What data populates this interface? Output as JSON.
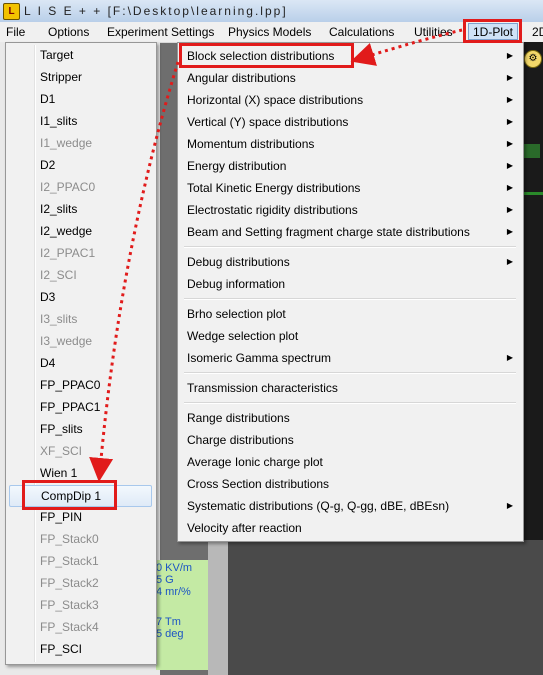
{
  "window": {
    "title": "L I S E + +  [F:\\Desktop\\learning.lpp]",
    "icon": "lise-app-icon"
  },
  "menubar": {
    "items": [
      "File",
      "Options",
      "Experiment Settings",
      "Physics Models",
      "Calculations",
      "Utilities",
      "1D-Plot",
      "2D"
    ]
  },
  "left_menu": {
    "items": [
      {
        "label": "Target",
        "enabled": true
      },
      {
        "label": "Stripper",
        "enabled": true
      },
      {
        "label": "D1",
        "enabled": true
      },
      {
        "label": "I1_slits",
        "enabled": true
      },
      {
        "label": "I1_wedge",
        "enabled": false
      },
      {
        "label": "D2",
        "enabled": true
      },
      {
        "label": "I2_PPAC0",
        "enabled": false
      },
      {
        "label": "I2_slits",
        "enabled": true
      },
      {
        "label": "I2_wedge",
        "enabled": true
      },
      {
        "label": "I2_PPAC1",
        "enabled": false
      },
      {
        "label": "I2_SCI",
        "enabled": false
      },
      {
        "label": "D3",
        "enabled": true
      },
      {
        "label": "I3_slits",
        "enabled": false
      },
      {
        "label": "I3_wedge",
        "enabled": false
      },
      {
        "label": "D4",
        "enabled": true
      },
      {
        "label": "FP_PPAC0",
        "enabled": true
      },
      {
        "label": "FP_PPAC1",
        "enabled": true
      },
      {
        "label": "FP_slits",
        "enabled": true
      },
      {
        "label": "XF_SCI",
        "enabled": false
      },
      {
        "label": "Wien 1",
        "enabled": true
      },
      {
        "label": "CompDip 1",
        "enabled": true,
        "selected": true
      },
      {
        "label": "FP_PIN",
        "enabled": true
      },
      {
        "label": "FP_Stack0",
        "enabled": false
      },
      {
        "label": "FP_Stack1",
        "enabled": false
      },
      {
        "label": "FP_Stack2",
        "enabled": false
      },
      {
        "label": "FP_Stack3",
        "enabled": false
      },
      {
        "label": "FP_Stack4",
        "enabled": false
      },
      {
        "label": "FP_SCI",
        "enabled": true
      }
    ]
  },
  "right_menu": {
    "groups": [
      [
        {
          "label": "Block selection distributions",
          "submenu": true
        },
        {
          "label": "Angular distributions",
          "submenu": true
        },
        {
          "label": "Horizontal (X) space  distributions",
          "submenu": true
        },
        {
          "label": "Vertical (Y) space  distributions",
          "submenu": true
        },
        {
          "label": "Momentum distributions",
          "submenu": true
        },
        {
          "label": "Energy distribution",
          "submenu": true
        },
        {
          "label": "Total Kinetic Energy distributions",
          "submenu": true
        },
        {
          "label": "Electrostatic rigidity distributions",
          "submenu": true
        },
        {
          "label": "Beam and Setting fragment charge state distributions",
          "submenu": true
        }
      ],
      [
        {
          "label": "Debug distributions",
          "submenu": true
        },
        {
          "label": "Debug information",
          "submenu": false
        }
      ],
      [
        {
          "label": "Brho selection plot",
          "submenu": false
        },
        {
          "label": "Wedge selection plot",
          "submenu": false
        },
        {
          "label": "Isomeric Gamma spectrum",
          "submenu": true
        }
      ],
      [
        {
          "label": "Transmission characteristics",
          "submenu": false
        }
      ],
      [
        {
          "label": "Range distributions",
          "submenu": false
        },
        {
          "label": "Charge distributions",
          "submenu": false
        },
        {
          "label": "Average Ionic charge plot",
          "submenu": false
        },
        {
          "label": "Cross Section distributions",
          "submenu": false
        },
        {
          "label": "Systematic distributions (Q-g, Q-gg, dBE, dBEsn)",
          "submenu": true
        },
        {
          "label": "Velocity after reaction",
          "submenu": false
        }
      ]
    ]
  },
  "background_panel": {
    "lines": [
      "0 KV/m",
      "5 G",
      "4 mr/%",
      "7 Tm",
      "5 deg"
    ]
  },
  "annotation": {
    "color": "#e11b1b"
  },
  "icons": {
    "submenu_arrow": "triangle-right",
    "gear": "gear-icon"
  }
}
